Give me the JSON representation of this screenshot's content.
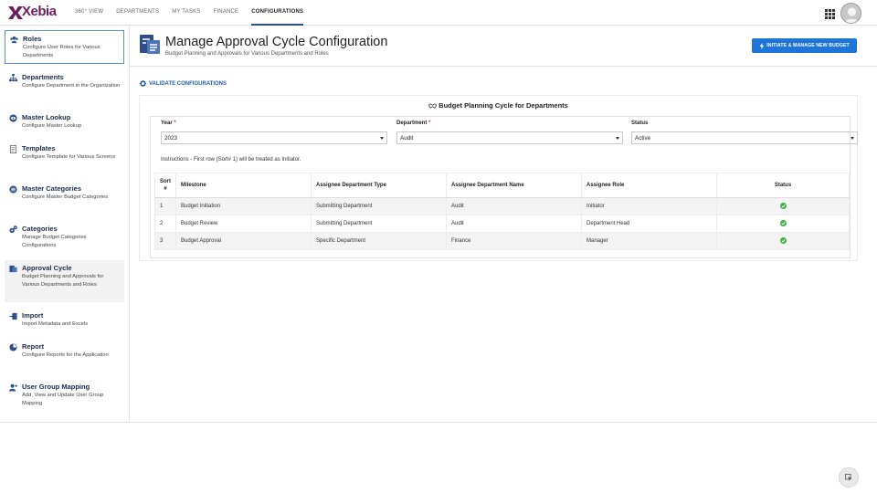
{
  "brand": {
    "logo_text": "Xebia",
    "color": "#6c1d5f"
  },
  "nav": [
    {
      "label": "360° VIEW"
    },
    {
      "label": "DEPARTMENTS"
    },
    {
      "label": "MY TASKS"
    },
    {
      "label": "FINANCE"
    },
    {
      "label": "CONFIGURATIONS",
      "active": true
    }
  ],
  "sidebar": {
    "items": [
      {
        "title": "Roles",
        "desc": "Configure User Roles for Various Departments",
        "icon": "users-icon"
      },
      {
        "title": "Departments",
        "desc": "Configure Department in the Organization",
        "icon": "sitemap-icon"
      },
      {
        "title": "Master Lookup",
        "desc": "Configure Master Lookup",
        "icon": "eye-circle-icon"
      },
      {
        "title": "Templates",
        "desc": "Configure Template for Various Screens",
        "icon": "document-icon"
      },
      {
        "title": "Master Categories",
        "desc": "Configure Master Budget Categories",
        "icon": "database-icon"
      },
      {
        "title": "Categories",
        "desc": "Manage Budget Categories Configurations",
        "icon": "cogs-icon"
      },
      {
        "title": "Approval Cycle",
        "desc": "Budget Planning and Approvals for Various Departments and Roles",
        "icon": "approval-icon"
      },
      {
        "title": "Import",
        "desc": "Import Metadata and Excels",
        "icon": "import-icon"
      },
      {
        "title": "Report",
        "desc": "Configure Reports for the Application",
        "icon": "chart-circle-icon"
      },
      {
        "title": "User Group Mapping",
        "desc": "Add, View and Update User Group Mapping",
        "icon": "user-group-icon"
      }
    ]
  },
  "header": {
    "title": "Manage Approval Cycle Configuration",
    "subtitle": "Budget Planning and Approvals for Various Departments and Roles",
    "primary_button": "INITIATE & MANAGE NEW BUDGET"
  },
  "validate_label": "VALIDATE CONFIGURATIONS",
  "card": {
    "title": "Budget Planning Cycle for Departments",
    "filters": {
      "year": {
        "label": "Year",
        "required_mark": "*",
        "value": "2023"
      },
      "department": {
        "label": "Department",
        "required_mark": "*",
        "value": "Audit"
      },
      "status": {
        "label": "Status",
        "value": "Active"
      }
    },
    "instructions": "Instructions - First row (Sort# 1) will be treated as Initiator.",
    "table": {
      "headers": {
        "sort_line1": "Sort",
        "sort_line2": "#",
        "milestone": "Milestone",
        "dept_type": "Assignee Department Type",
        "dept_name": "Assignee Department Name",
        "role": "Assignee Role",
        "status": "Status"
      },
      "rows": [
        {
          "sort": "1",
          "milestone": "Budget Initiation",
          "dept_type": "Submitting Department",
          "dept_name": "Audit",
          "role": "Initiator",
          "status": "active"
        },
        {
          "sort": "2",
          "milestone": "Budget Review",
          "dept_type": "Submitting Department",
          "dept_name": "Audit",
          "role": "Department Head",
          "status": "active"
        },
        {
          "sort": "3",
          "milestone": "Budget Approval",
          "dept_type": "Specific Department",
          "dept_name": "Finance",
          "role": "Manager",
          "status": "active"
        }
      ]
    }
  },
  "colors": {
    "accent": "#1f74d8",
    "success": "#3cb043",
    "nav_underline": "#2d4e8a"
  }
}
